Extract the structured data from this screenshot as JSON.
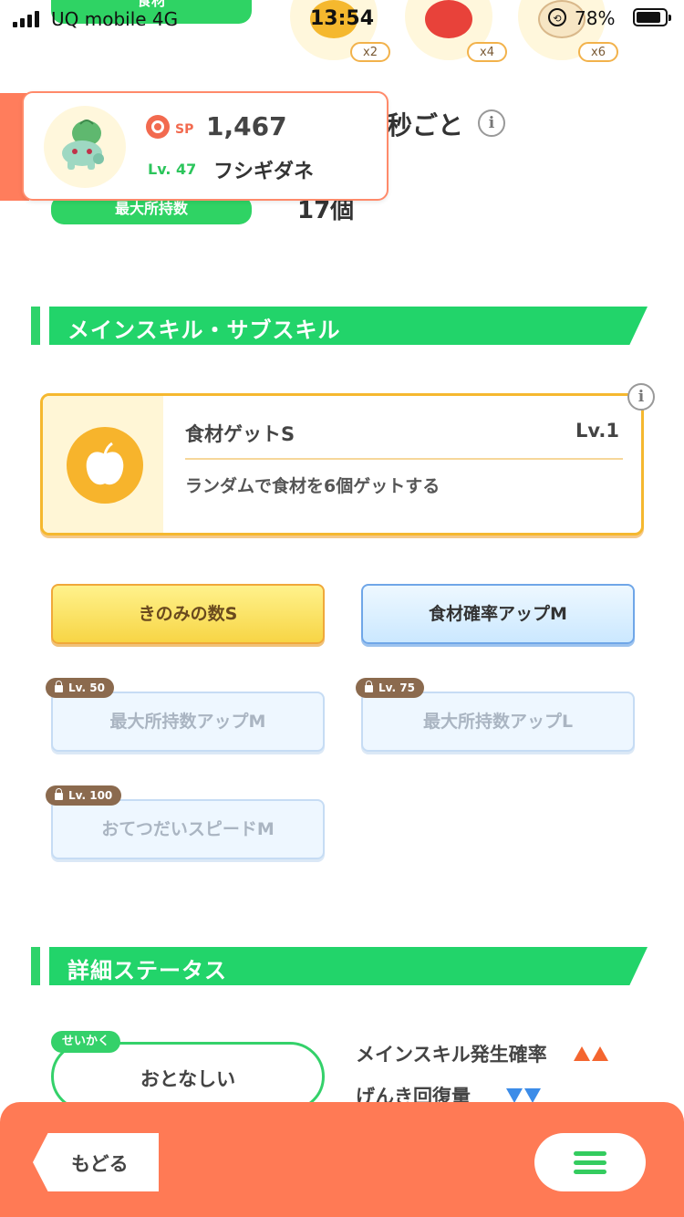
{
  "status_bar": {
    "carrier": "UQ mobile  4G",
    "time": "13:54",
    "battery": "78%"
  },
  "top_section": {
    "ingredient_tag": "食材",
    "ingredients": [
      {
        "qty": "x2",
        "color": "#f5b82e"
      },
      {
        "qty": "x4",
        "color": "#e8423a"
      },
      {
        "qty": "x6",
        "color": "#f7e6c4"
      }
    ],
    "behind_text": "秒ごと",
    "max_tag": "最大所持数",
    "max_value": "17個"
  },
  "pokemon_card": {
    "sp_label": "SP",
    "sp_value": "1,467",
    "level": "Lv. 47",
    "name": "フシギダネ"
  },
  "skills_section": {
    "title": "メインスキル・サブスキル",
    "main_skill": {
      "name": "食材ゲットS",
      "level": "Lv.1",
      "description": "ランダムで食材を6個ゲットする"
    },
    "sub_skills": [
      {
        "label": "きのみの数S",
        "style": "gold"
      },
      {
        "label": "食材確率アップM",
        "style": "blue"
      },
      {
        "label": "最大所持数アップM",
        "lock": "Lv. 50"
      },
      {
        "label": "最大所持数アップL",
        "lock": "Lv. 75"
      },
      {
        "label": "おてつだいスピードM",
        "lock": "Lv. 100"
      }
    ]
  },
  "details_section": {
    "title": "詳細ステータス",
    "nature_tag": "せいかく",
    "nature_value": "おとなしい",
    "stats": [
      {
        "label": "メインスキル発生確率",
        "arrows": "up"
      },
      {
        "label": "げんき回復量",
        "arrows": "down"
      }
    ]
  },
  "bottom_bar": {
    "back_label": "もどる"
  },
  "colors": {
    "green": "#22d46a",
    "orange": "#ff7a55",
    "gold": "#f5b82f"
  }
}
